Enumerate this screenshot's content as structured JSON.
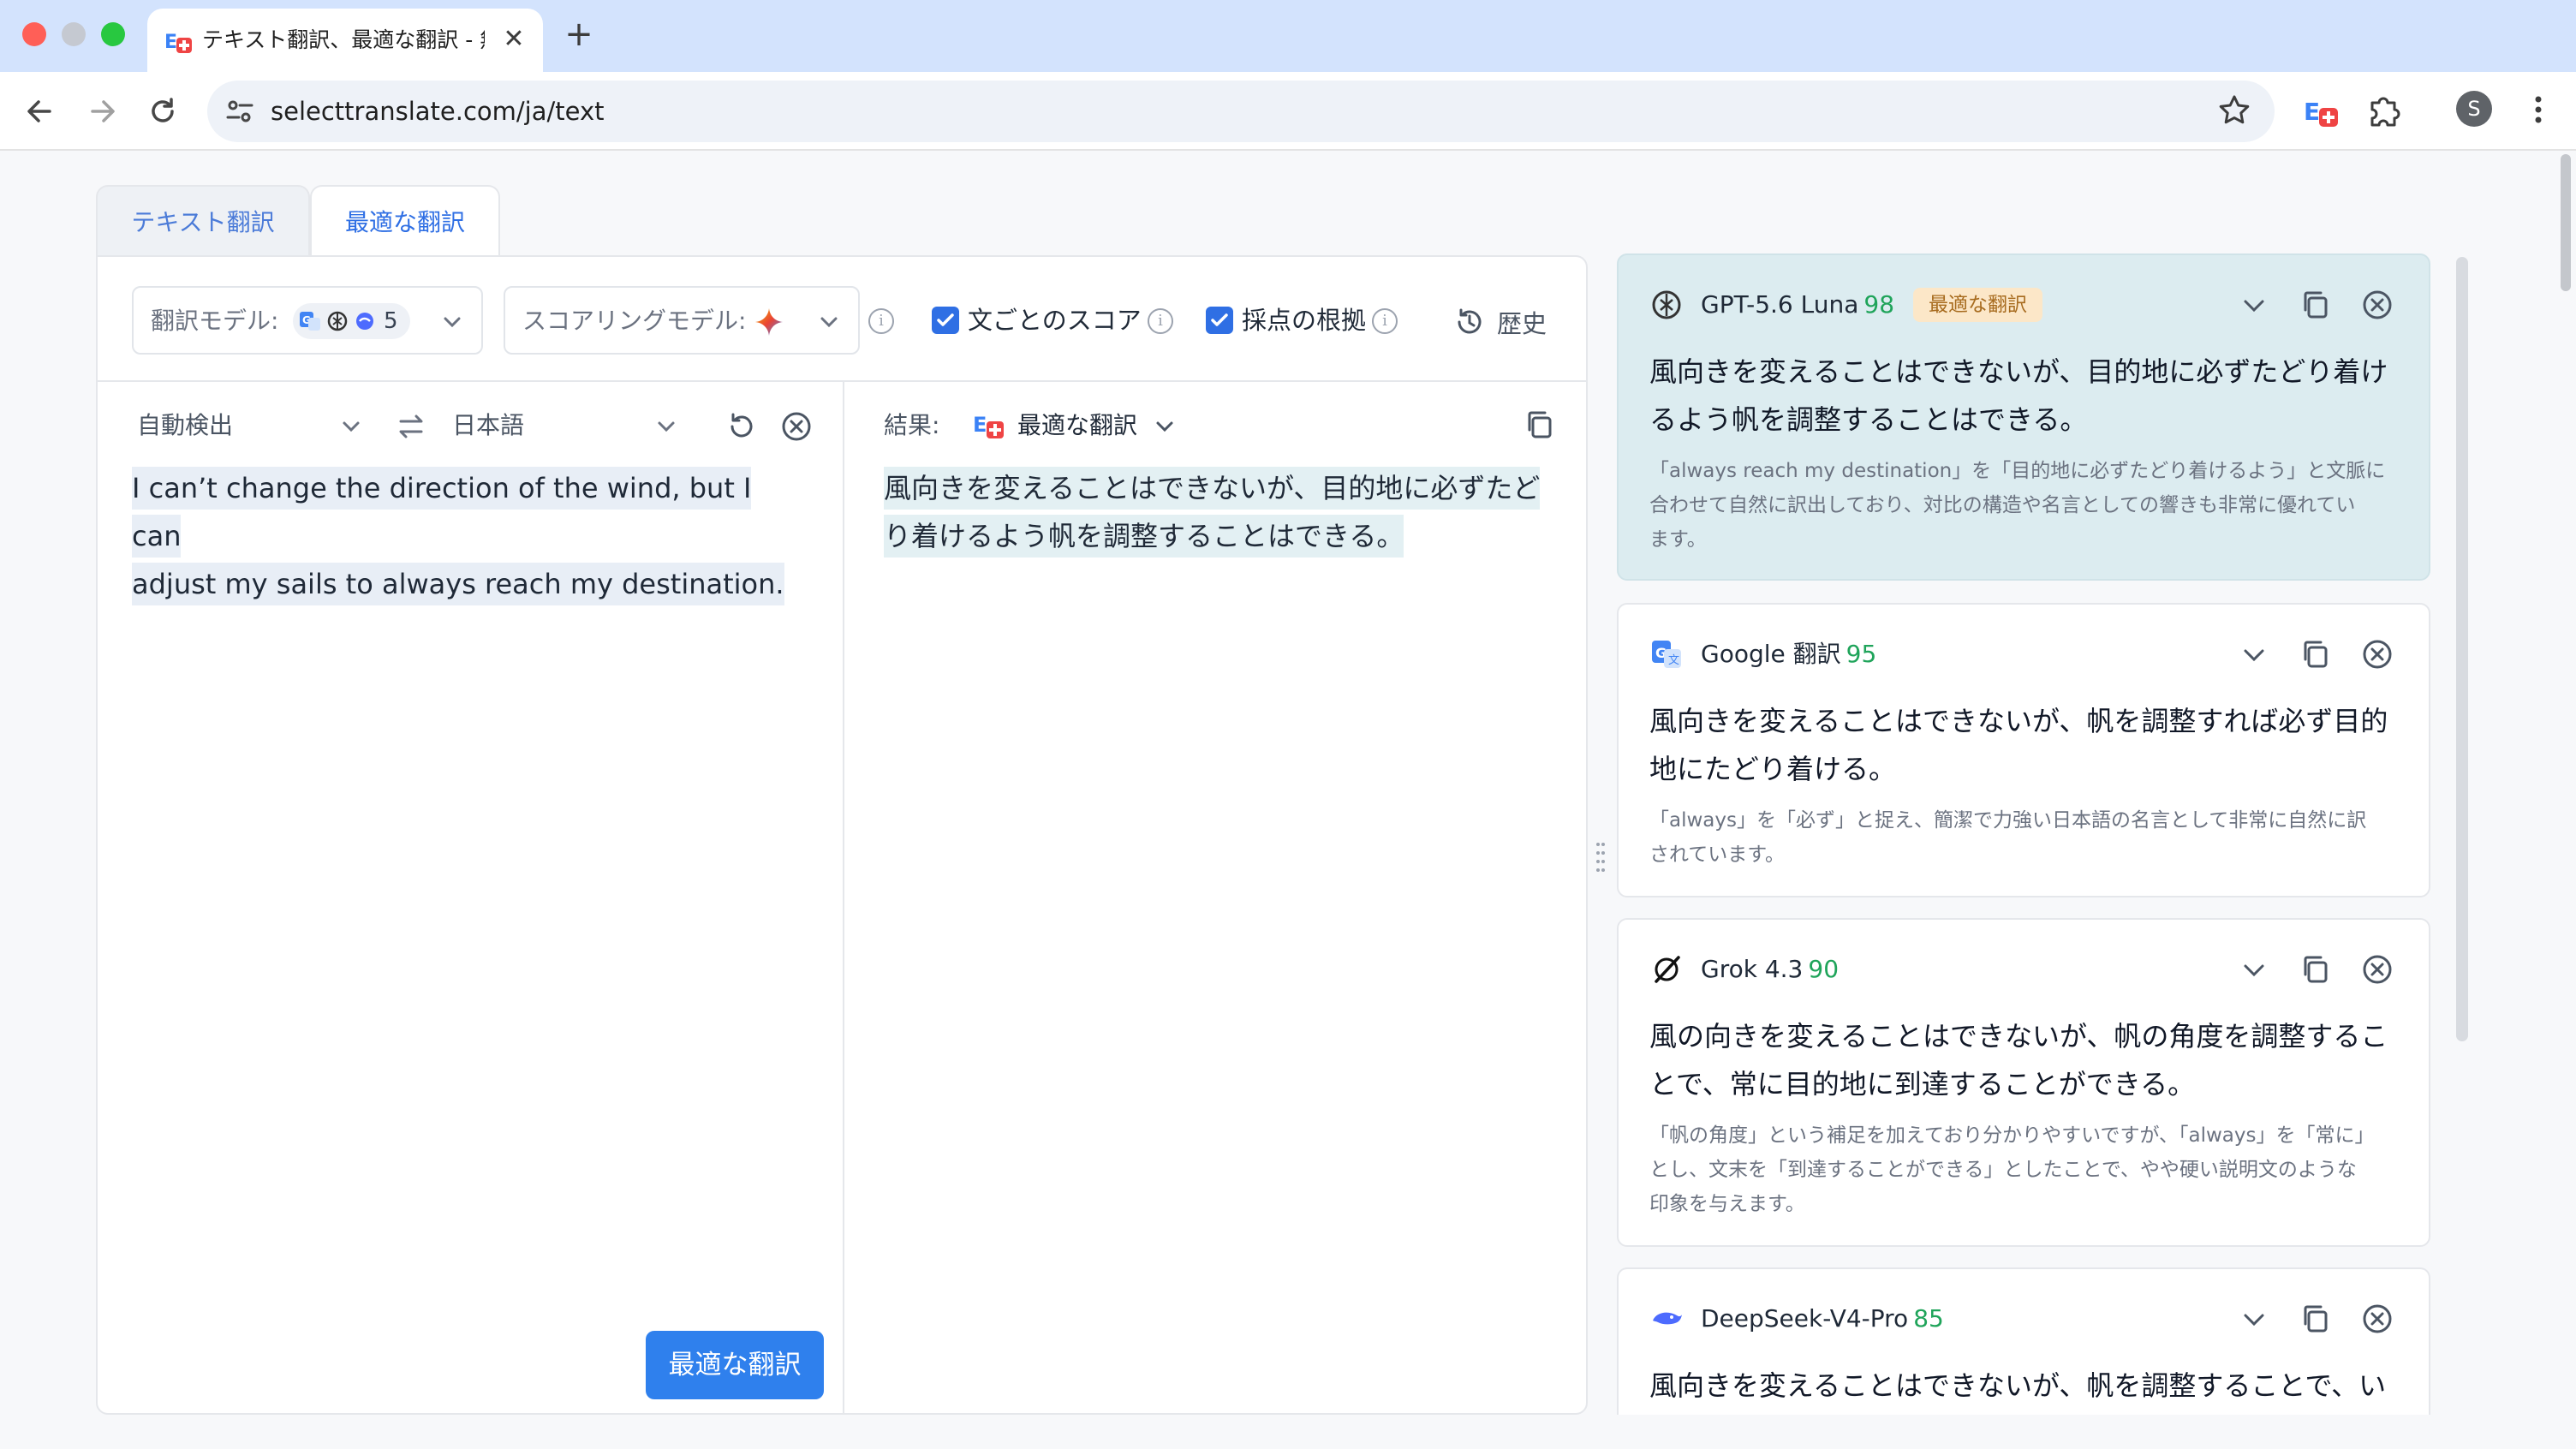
{
  "browser": {
    "tab_title": "テキスト翻訳、最適な翻訳 - 無",
    "tab_close": "✕",
    "new_tab": "+",
    "url": "selecttranslate.com/ja/text",
    "profile_initial": "S",
    "icons": [
      "back-icon",
      "forward-icon",
      "reload-icon",
      "site-info-icon",
      "star-icon",
      "translate-extension-icon",
      "puzzle-extension-icon",
      "kebab-menu-icon"
    ]
  },
  "page_tabs": [
    "テキスト翻訳",
    "最適な翻訳"
  ],
  "controls": {
    "translation_models_label": "翻訳モデル:",
    "translation_models_count": "5",
    "scoring_model_label": "スコアリングモデル:",
    "sentence_score_label": "文ごとのスコア",
    "sentence_score_checked": true,
    "scoring_reason_label": "採点の根拠",
    "scoring_reason_checked": true,
    "history_label": "歴史"
  },
  "source": {
    "language": "自動検出",
    "target_language": "日本語",
    "text_line1": "I can’t change the direction of the wind, but I can",
    "text_line2": "adjust my sails to always reach my destination."
  },
  "result": {
    "label": "結果:",
    "mode": "最適な翻訳",
    "text_line1": "風向きを変えることはできないが、目的地に必ずたど",
    "text_line2": "り着けるよう帆を調整することはできる。"
  },
  "translate_button": "最適な翻訳",
  "colors": {
    "accent": "#2f80ed",
    "score_green": "#1fa45a",
    "best_card_bg": "#dcecf0",
    "badge_bg": "#fce7c8"
  },
  "results": [
    {
      "model": "GPT-5.6 Luna",
      "score": "98",
      "badge": "最適な翻訳",
      "icon": "openai-icon",
      "line1": "風向きを変えることはできないが、目的地に必ずたどり着け",
      "line2": "るよう帆を調整することはできる。",
      "note1": "「always reach my destination」を「目的地に必ずたどり着けるよう」と文脈に",
      "note2": "合わせて自然に訳出しており、対比の構造や名言としての響きも非常に優れてい",
      "note3": "ます。"
    },
    {
      "model": "Google 翻訳",
      "score": "95",
      "icon": "google-translate-icon",
      "line1": "風向きを変えることはできないが、帆を調整すれば必ず目的",
      "line2": "地にたどり着ける。",
      "note1": "「always」を「必ず」と捉え、簡潔で力強い日本語の名言として非常に自然に訳",
      "note2": "されています。"
    },
    {
      "model": "Grok 4.3",
      "score": "90",
      "icon": "grok-icon",
      "line1": "風の向きを変えることはできないが、帆の角度を調整するこ",
      "line2": "とで、常に目的地に到達することができる。",
      "note1": "「帆の角度」という補足を加えており分かりやすいですが、「always」を「常に」",
      "note2": "とし、文末を「到達することができる」としたことで、やや硬い説明文のような",
      "note3": "印象を与えます。"
    },
    {
      "model": "DeepSeek-V4-Pro",
      "score": "85",
      "icon": "deepseek-icon",
      "line1": "風向きを変えることはできないが、帆を調整することで、い"
    }
  ]
}
